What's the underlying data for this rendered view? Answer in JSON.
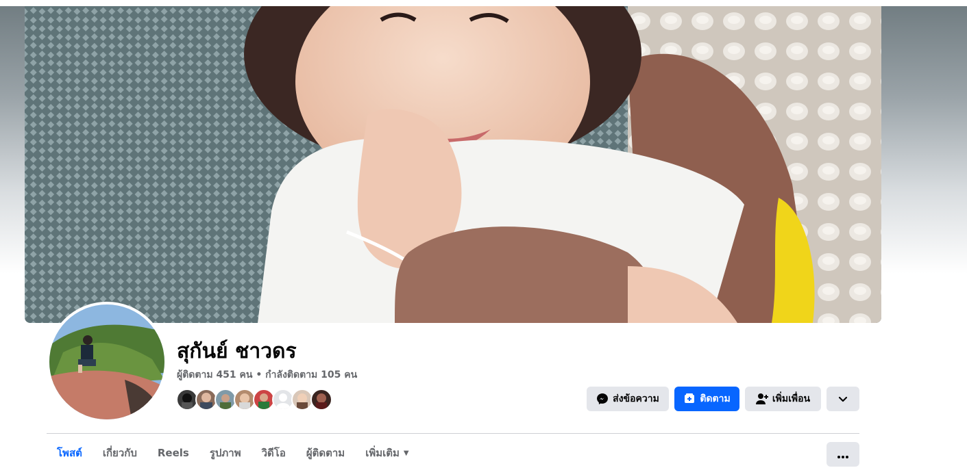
{
  "profile": {
    "name": "สุกันย์ ชาวดร",
    "follow_stats": "ผู้ติดตาม 451 คน • กำลังติดตาม 105 คน",
    "friend_faces_count": 8
  },
  "actions": {
    "message_label": "ส่งข้อความ",
    "follow_label": "ติดตาม",
    "add_friend_label": "เพิ่มเพื่อน"
  },
  "tabs": [
    {
      "label": "โพสต์",
      "active": true
    },
    {
      "label": "เกี่ยวกับ",
      "active": false
    },
    {
      "label": "Reels",
      "active": false
    },
    {
      "label": "รูปภาพ",
      "active": false
    },
    {
      "label": "วิดีโอ",
      "active": false
    },
    {
      "label": "ผู้ติดตาม",
      "active": false
    },
    {
      "label": "เพิ่มเติม",
      "active": false
    }
  ],
  "colors": {
    "accent": "#0866ff",
    "button_grey": "#e4e6eb",
    "text_primary": "#050505",
    "text_secondary": "#65676b"
  },
  "icons": {
    "message": "messenger-icon",
    "follow": "follow-icon",
    "add_friend": "add-friend-icon",
    "dropdown": "chevron-down-icon",
    "more": "ellipsis-icon"
  }
}
